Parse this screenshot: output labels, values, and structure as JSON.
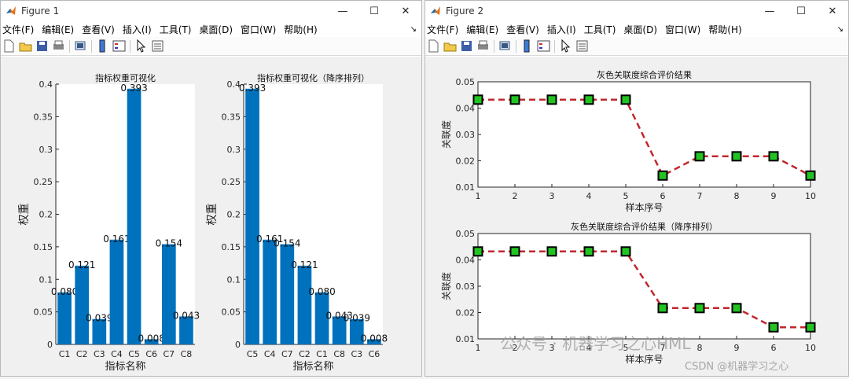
{
  "figure1": {
    "title": "Figure 1",
    "menu": [
      "文件(F)",
      "编辑(E)",
      "查看(V)",
      "插入(I)",
      "工具(T)",
      "桌面(D)",
      "窗口(W)",
      "帮助(H)"
    ],
    "window_controls": [
      "—",
      "☐",
      "✕"
    ]
  },
  "figure2": {
    "title": "Figure 2",
    "menu": [
      "文件(F)",
      "编辑(E)",
      "查看(V)",
      "插入(I)",
      "工具(T)",
      "桌面(D)",
      "窗口(W)",
      "帮助(H)"
    ],
    "window_controls": [
      "—",
      "☐",
      "✕"
    ]
  },
  "toolbar_icons": [
    "new-icon",
    "open-icon",
    "save-icon",
    "print-icon",
    "link-icon",
    "colorbar-icon",
    "legend-icon",
    "pointer-icon",
    "property-icon"
  ],
  "colors": {
    "bar": "#0072bd",
    "line": "#c1272d",
    "marker": "#22c422",
    "marker_edge": "#000000"
  },
  "watermark": {
    "wechat": "公众号 · 机器学习之心HML",
    "csdn": "CSDN @机器学习之心"
  },
  "chart_data": [
    {
      "type": "bar",
      "title": "指标权重可视化",
      "xlabel": "指标名称",
      "ylabel": "权重",
      "categories": [
        "C1",
        "C2",
        "C3",
        "C4",
        "C5",
        "C6",
        "C7",
        "C8"
      ],
      "values": [
        0.08,
        0.121,
        0.039,
        0.161,
        0.393,
        0.008,
        0.154,
        0.043
      ],
      "value_labels": [
        "0.080",
        "0.121",
        "0.039",
        "0.161",
        "0.393",
        "0.008",
        "0.154",
        "0.043"
      ],
      "ylim": [
        0,
        0.4
      ],
      "yticks": [
        "0",
        "0.05",
        "0.1",
        "0.15",
        "0.2",
        "0.25",
        "0.3",
        "0.35",
        "0.4"
      ]
    },
    {
      "type": "bar",
      "title": "指标权重可视化（降序排列）",
      "xlabel": "指标名称",
      "ylabel": "权重",
      "categories": [
        "C5",
        "C4",
        "C7",
        "C2",
        "C1",
        "C8",
        "C3",
        "C6"
      ],
      "values": [
        0.393,
        0.161,
        0.154,
        0.121,
        0.08,
        0.043,
        0.039,
        0.008
      ],
      "value_labels": [
        "0.393",
        "0.161",
        "0.154",
        "0.121",
        "0.080",
        "0.043",
        "0.039",
        "0.008"
      ],
      "ylim": [
        0,
        0.4
      ],
      "yticks": [
        "0",
        "0.05",
        "0.1",
        "0.15",
        "0.2",
        "0.25",
        "0.3",
        "0.35",
        "0.4"
      ]
    },
    {
      "type": "line",
      "title": "灰色关联度综合评价结果",
      "xlabel": "样本序号",
      "ylabel": "关联度",
      "x": [
        "1",
        "2",
        "3",
        "4",
        "5",
        "6",
        "7",
        "8",
        "9",
        "10"
      ],
      "values": [
        0.0432,
        0.0432,
        0.0432,
        0.0432,
        0.0432,
        0.0144,
        0.0217,
        0.0217,
        0.0217,
        0.0144
      ],
      "ylim": [
        0.01,
        0.05
      ],
      "yticks": [
        "0.01",
        "0.02",
        "0.03",
        "0.04",
        "0.05"
      ]
    },
    {
      "type": "line",
      "title": "灰色关联度综合评价结果（降序排列）",
      "xlabel": "样本序号",
      "ylabel": "关联度",
      "x": [
        "1",
        "2",
        "3",
        "4",
        "5",
        "7",
        "8",
        "9",
        "6",
        "10"
      ],
      "values": [
        0.0432,
        0.0432,
        0.0432,
        0.0432,
        0.0432,
        0.0217,
        0.0217,
        0.0217,
        0.0144,
        0.0144
      ],
      "ylim": [
        0.01,
        0.05
      ],
      "yticks": [
        "0.01",
        "0.02",
        "0.03",
        "0.04",
        "0.05"
      ]
    }
  ]
}
